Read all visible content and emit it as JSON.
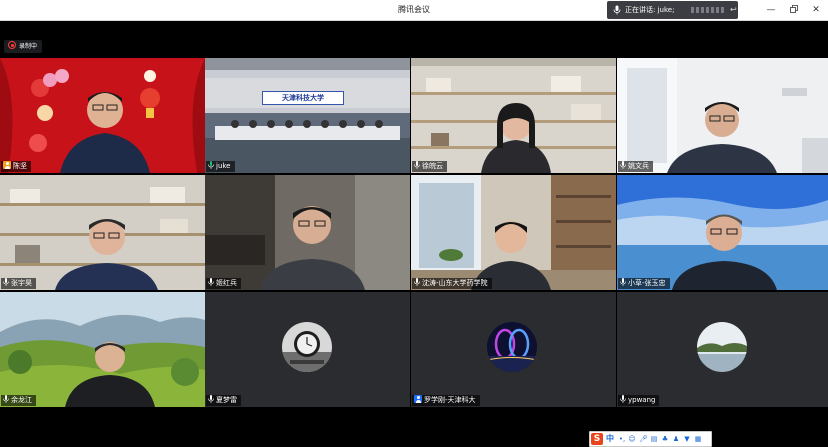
{
  "window": {
    "title": "腾讯会议",
    "controls": [
      "—",
      "□",
      "✕"
    ]
  },
  "speaking": {
    "label": "正在讲话: juke;"
  },
  "recording": {
    "label": "录制中"
  },
  "participants": [
    {
      "name": "陈坚",
      "icon": "host-user-icon"
    },
    {
      "name": "juke",
      "icon": "mic-icon"
    },
    {
      "name": "徐皖云",
      "icon": "mic-icon"
    },
    {
      "name": "姚文兵",
      "icon": "mic-icon"
    },
    {
      "name": "张宇昊",
      "icon": "mic-icon"
    },
    {
      "name": "姬红兵",
      "icon": "mic-icon"
    },
    {
      "name": "沈涛-山东大学药学院",
      "icon": "mic-icon"
    },
    {
      "name": "小草-张玉忠",
      "icon": "mic-icon"
    },
    {
      "name": "余龙江",
      "icon": "mic-icon"
    },
    {
      "name": "夏梦雷",
      "icon": "mic-icon"
    },
    {
      "name": "罗学刚-天津科大",
      "icon": "user-icon"
    },
    {
      "name": "ypwang",
      "icon": "mic-icon"
    }
  ],
  "banner": {
    "text": "天津科技大学"
  },
  "ime": {
    "logo": "S",
    "mode": "中"
  },
  "colors": {
    "accent": "#1e6fff",
    "record": "#ff3b3b",
    "tile_bg": "#2b2c30",
    "festive_red": "#d0141a"
  }
}
